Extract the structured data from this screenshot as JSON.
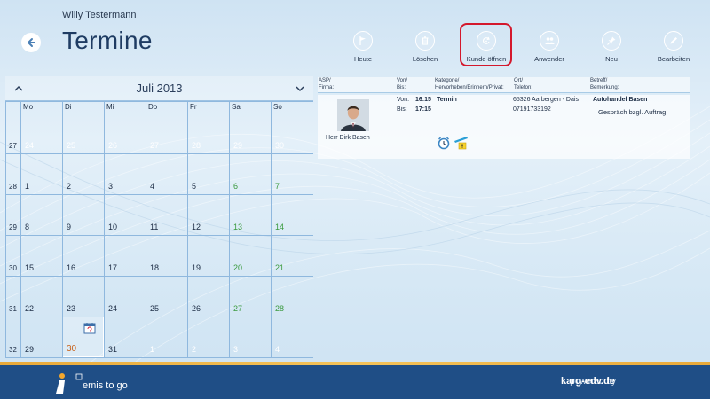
{
  "header": {
    "user_name": "Willy Testermann",
    "title": "Termine"
  },
  "toolbar": {
    "buttons": [
      {
        "label": "Heute",
        "icon": "flag-icon"
      },
      {
        "label": "Löschen",
        "icon": "trash-icon"
      },
      {
        "label": "Kunde öffnen",
        "icon": "open-customer-icon"
      },
      {
        "label": "Anwender",
        "icon": "users-icon"
      },
      {
        "label": "Neu",
        "icon": "pin-icon"
      },
      {
        "label": "Bearbeiten",
        "icon": "pencil-icon"
      }
    ],
    "highlighted": "Kunde öffnen"
  },
  "calendar": {
    "month_label": "Juli 2013",
    "weekdays": [
      "Mo",
      "Di",
      "Mi",
      "Do",
      "Fr",
      "Sa",
      "So"
    ],
    "weeks": [
      {
        "no": "27",
        "days": [
          "24",
          "25",
          "26",
          "27",
          "28",
          "29",
          "30"
        ]
      },
      {
        "no": "28",
        "days": [
          "1",
          "2",
          "3",
          "4",
          "5",
          "6",
          "7"
        ]
      },
      {
        "no": "29",
        "days": [
          "8",
          "9",
          "10",
          "11",
          "12",
          "13",
          "14"
        ]
      },
      {
        "no": "30",
        "days": [
          "15",
          "16",
          "17",
          "18",
          "19",
          "20",
          "21"
        ]
      },
      {
        "no": "31",
        "days": [
          "22",
          "23",
          "24",
          "25",
          "26",
          "27",
          "28"
        ]
      },
      {
        "no": "32",
        "days": [
          "29",
          "30",
          "31",
          "1",
          "2",
          "3",
          "4"
        ]
      }
    ],
    "today": "30",
    "colors": {
      "weekend": "#3a9a3e",
      "today": "#c8641e",
      "other_month": "#ffffff"
    }
  },
  "appointments": {
    "headers": {
      "asp": "ASP/",
      "firma": "Firma:",
      "von": "Von/",
      "bis": "Bis:",
      "kategorie": "Kategorie/",
      "hervorheben": "Hervorheben/Erinnern/Privat:",
      "ort": "Ort/",
      "telefon": "Telefon:",
      "betreff": "Betreff/",
      "bemerkung": "Bemerkung:"
    },
    "items": [
      {
        "contact": "Herr Dirk Basen",
        "von_label": "Von:",
        "von": "16:15",
        "bis_label": "Bis:",
        "bis": "17:15",
        "type": "Termin",
        "location": "65326 Aarbergen - Dais",
        "phone": "07191733192",
        "company": "Autohandel Basen",
        "subject": "Gespräch bzgl. Auftrag"
      }
    ]
  },
  "footer": {
    "logo_text": "emis to go",
    "powered_by": "powered by",
    "brand": "karg-edv.de"
  }
}
